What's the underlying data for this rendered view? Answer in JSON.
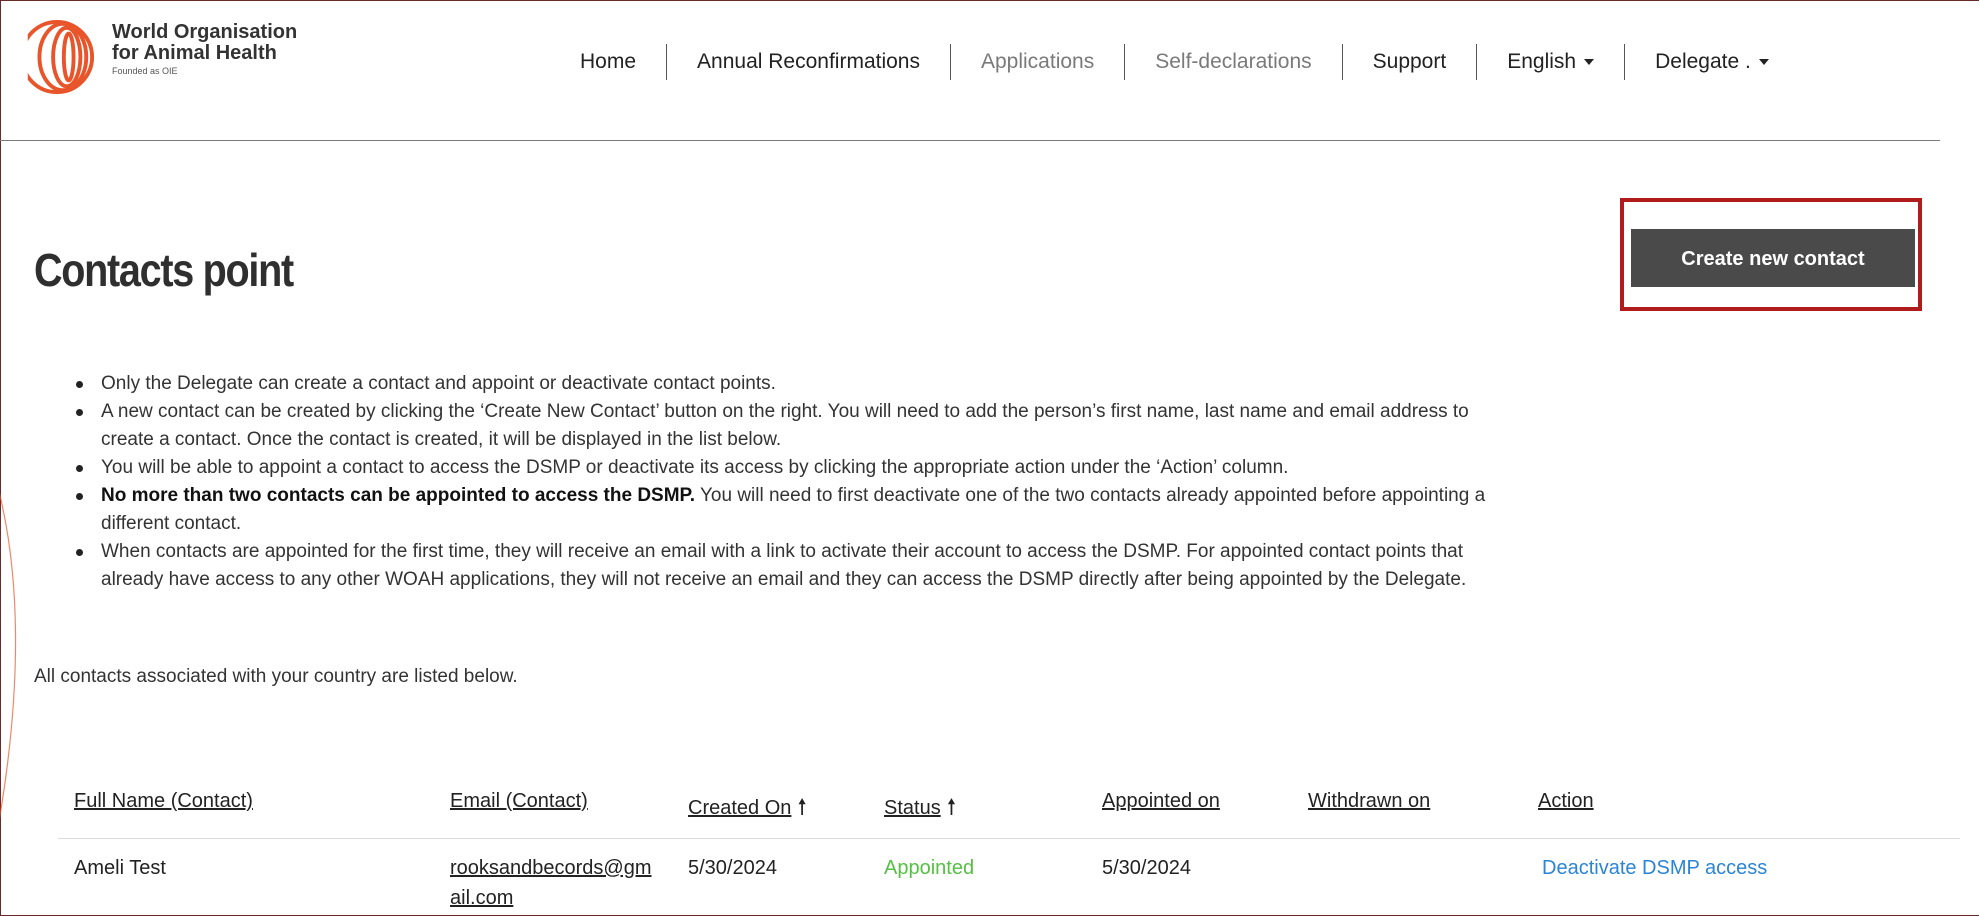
{
  "org": {
    "name_line1": "World Organisation",
    "name_line2": "for Animal Health",
    "tagline": "Founded as OIE"
  },
  "nav": {
    "home": "Home",
    "annual": "Annual Reconfirmations",
    "applications": "Applications",
    "self_declarations": "Self-declarations",
    "support": "Support",
    "language": "English",
    "user": "Delegate ."
  },
  "page": {
    "title": "Contacts point",
    "create_button": "Create new contact"
  },
  "info": {
    "b1": "Only the Delegate can create a contact and appoint or deactivate contact points.",
    "b2_l1": "A new contact can be created by clicking the ‘Create New Contact’ button on the right. You will need to add the person’s first name, last name and email address to",
    "b2_l2": "create a contact. Once the contact is created, it will be displayed in the list below.",
    "b3": "You will be able to appoint a contact to access the DSMP or deactivate its access by clicking the appropriate action under the ‘Action’ column.",
    "b4_bold": "No more than two contacts can be appointed to access the DSMP.",
    "b4_rest_l1": " You will need to first deactivate one of the two contacts already appointed before appointing a",
    "b4_rest_l2": "different contact.",
    "b5_l1": "When contacts are appointed for the first time, they will receive an email with a link to activate their account to access the DSMP. For appointed contact points that",
    "b5_l2": "already have access to any other WOAH applications, they will not receive an email and they can access the DSMP directly after being appointed by the Delegate.",
    "all_contacts": "All contacts associated with your country are listed below."
  },
  "table": {
    "headers": {
      "full_name": "Full Name (Contact)",
      "email": "Email (Contact)",
      "created_on": "Created On",
      "status": "Status",
      "appointed_on": "Appointed on",
      "withdrawn_on": "Withdrawn on",
      "action": "Action"
    },
    "sort_arrow": "🠕",
    "rows": [
      {
        "full_name": "Ameli Test",
        "email": "rooksandbecords@gmail.com",
        "created_on": "5/30/2024",
        "status": "Appointed",
        "appointed_on": "5/30/2024",
        "withdrawn_on": "",
        "action": "Deactivate DSMP access"
      }
    ]
  },
  "colors": {
    "accent_orange": "#e8552b",
    "button_bg": "#4a4a4a",
    "highlight_red": "#b01c1c",
    "status_green": "#55c043",
    "link_blue": "#2c84d4"
  },
  "icons": {
    "logo": "woah-logo-icon",
    "caret": "chevron-down-icon",
    "sort": "arrow-up-icon"
  }
}
